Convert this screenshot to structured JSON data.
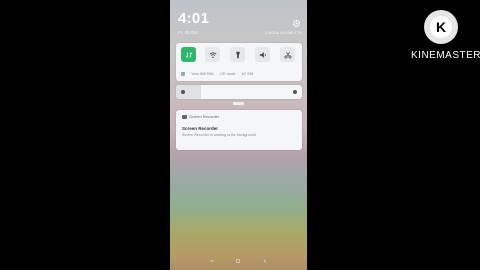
{
  "phone": {
    "time": "4:01",
    "date": "Fr, 20 Oct",
    "status_right": "0.4KB/s  Vol  5all  97%",
    "network_line": [
      "Yono  Wifi  PAN",
      "LTE  mode",
      "4G SIM"
    ],
    "quick_tiles": [
      {
        "icon": "data-icon",
        "active": true
      },
      {
        "icon": "wifi-icon",
        "active": false
      },
      {
        "icon": "flashlight-icon",
        "active": false
      },
      {
        "icon": "sound-icon",
        "active": false
      },
      {
        "icon": "scissors-icon",
        "active": false
      }
    ],
    "notification": {
      "app": "Screen Recorder",
      "title": "Screen Recorder",
      "body": "Screen Recorder is working in the background"
    },
    "brightness_level": 0.2
  },
  "watermark": {
    "brand": "KINEMASTER",
    "logo_letter": "K"
  },
  "colors": {
    "active_tile": "#2fb86a",
    "card_bg": "#f5f6f7"
  }
}
